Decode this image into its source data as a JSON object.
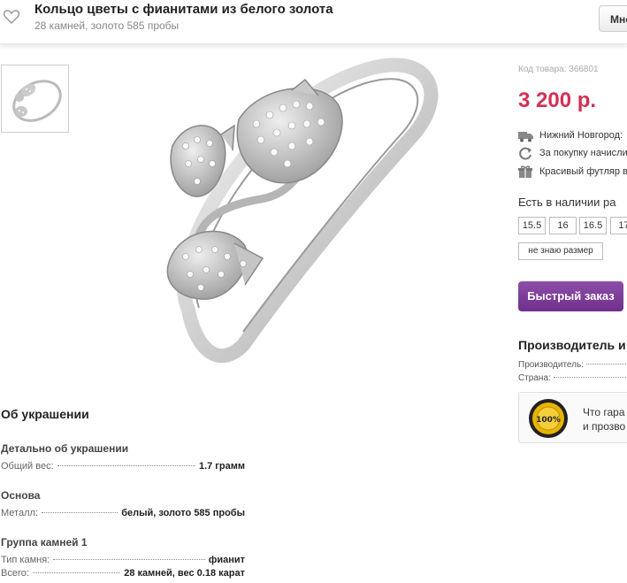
{
  "header": {
    "title": "Кольцо цветы с фианитами из белого золота",
    "subtitle": "28 камней, золото 585 пробы",
    "more_button": "Мно"
  },
  "gallery": {
    "thumbnail_alt": "ring-thumbnail",
    "main_image_alt": "ring-main-photo"
  },
  "about": {
    "heading": "Об украшении",
    "sections": [
      {
        "title": "Детально об украшении",
        "rows": [
          {
            "key": "Общий вес:",
            "value": "1.7 грамм"
          }
        ]
      },
      {
        "title": "Основа",
        "rows": [
          {
            "key": "Металл:",
            "value": "белый, золото 585 пробы"
          }
        ]
      },
      {
        "title": "Группа камней 1",
        "rows": [
          {
            "key": "Тип камня:",
            "value": "фианит"
          },
          {
            "key": "Всего:",
            "value": "28 камней, вес 0.18 карат"
          }
        ]
      }
    ]
  },
  "product": {
    "code": "Код товара: 366801",
    "price": "3 200 р.",
    "price_color": "#d52f55",
    "info": [
      {
        "icon": "truck-icon",
        "text": "Нижний Новгород:"
      },
      {
        "icon": "refresh-icon",
        "text": "За покупку начисли"
      },
      {
        "icon": "gift-icon",
        "text": "Красивый футляр в"
      }
    ],
    "availability": "Есть в наличии ра",
    "sizes": [
      "15.5",
      "16",
      "16.5",
      "17"
    ],
    "unknown_size": "не знаю размер",
    "quick_order": "Быстрый заказ",
    "accent_color": "#7a3a96"
  },
  "maker": {
    "heading": "Производитель и",
    "rows": [
      {
        "key": "Производитель:"
      },
      {
        "key": "Страна:"
      }
    ],
    "guarantee_line1": "Что гара",
    "guarantee_line2": "и прозво",
    "seal_text": "100%"
  }
}
